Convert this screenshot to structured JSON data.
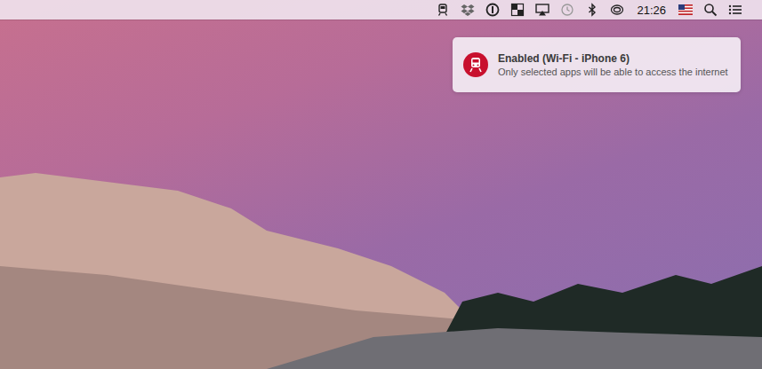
{
  "menu_bar": {
    "clock": "21:26"
  },
  "notification": {
    "title": "Enabled (Wi-Fi - iPhone 6)",
    "body": "Only selected apps will be able to access the internet"
  }
}
